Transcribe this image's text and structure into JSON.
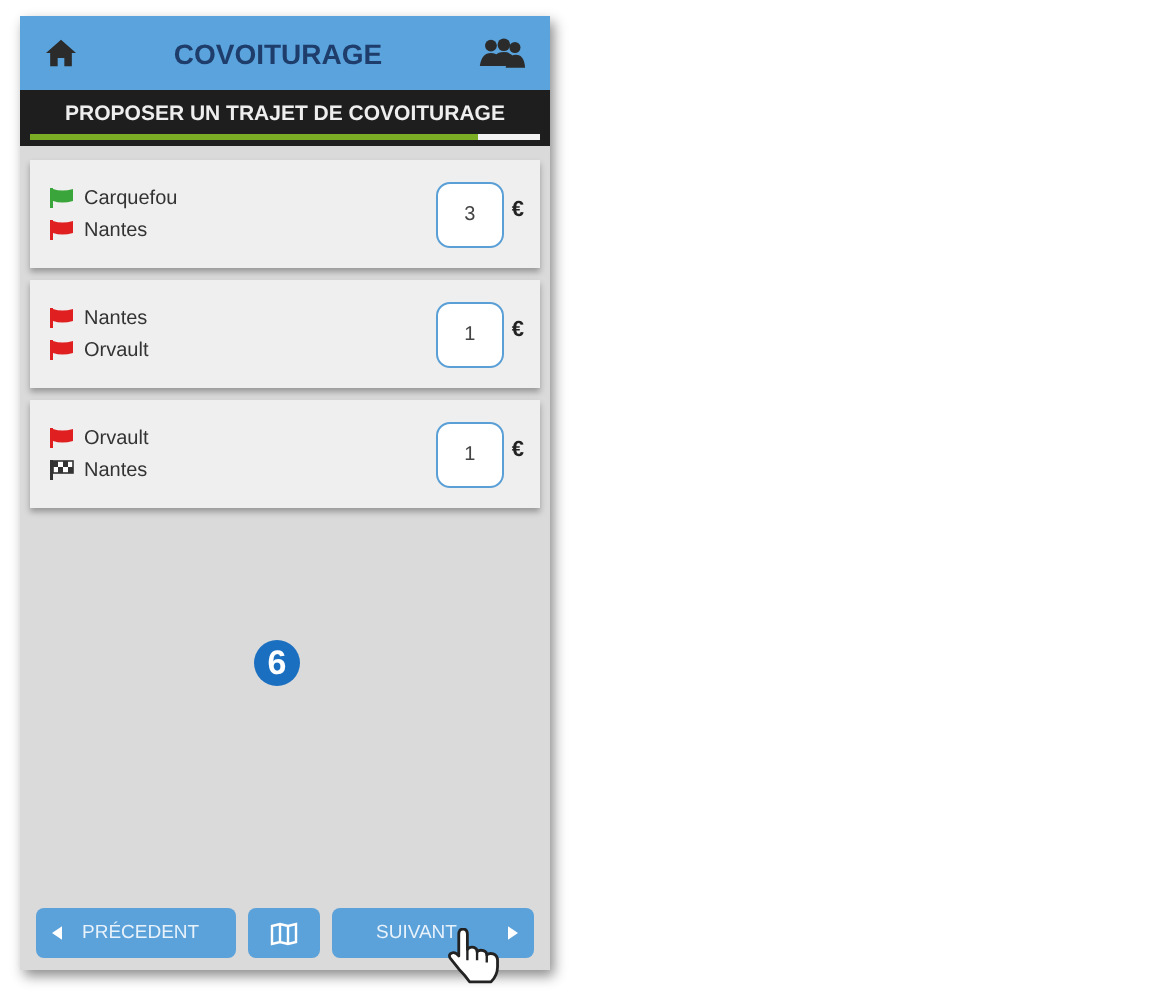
{
  "header": {
    "title": "COVOITURAGE"
  },
  "subheader": {
    "title": "PROPOSER UN TRAJET DE COVOITURAGE",
    "level": 0.88
  },
  "trips": [
    {
      "stops": [
        {
          "kind": "start",
          "name": "Carquefou"
        },
        {
          "kind": "step",
          "name": "Nantes"
        }
      ],
      "price": "3",
      "currency": "€"
    },
    {
      "stops": [
        {
          "kind": "step",
          "name": "Nantes"
        },
        {
          "kind": "step",
          "name": "Orvault"
        }
      ],
      "price": "1",
      "currency": "€"
    },
    {
      "stops": [
        {
          "kind": "step",
          "name": "Orvault"
        },
        {
          "kind": "finish",
          "name": "Nantes"
        }
      ],
      "price": "1",
      "currency": "€"
    }
  ],
  "step_badge": "6",
  "footer": {
    "previous": "PRÉCEDENT",
    "next": "SUIVANT"
  }
}
